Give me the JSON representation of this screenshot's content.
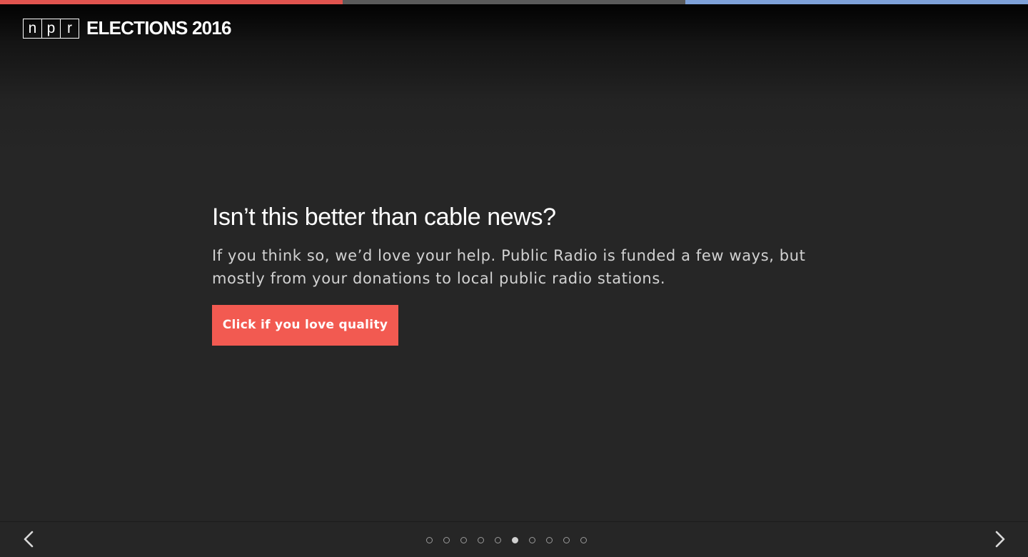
{
  "brand": {
    "logo_letters": [
      "n",
      "p",
      "r"
    ],
    "site_title": "ELECTIONS 2016"
  },
  "progress_colors": {
    "left": "#e0534e",
    "middle": "#5a5a5a",
    "right": "#7ea1d9"
  },
  "slide": {
    "headline": "Isn’t this better than cable news?",
    "body": "If you think so, we’d love your help. Public Radio is funded a few ways, but mostly from your donations to local public radio stations.",
    "cta_label": "Click if you love quality",
    "cta_color": "#f25a51"
  },
  "pager": {
    "total": 10,
    "active_index": 5,
    "prev_icon": "chevron-left-icon",
    "next_icon": "chevron-right-icon"
  }
}
